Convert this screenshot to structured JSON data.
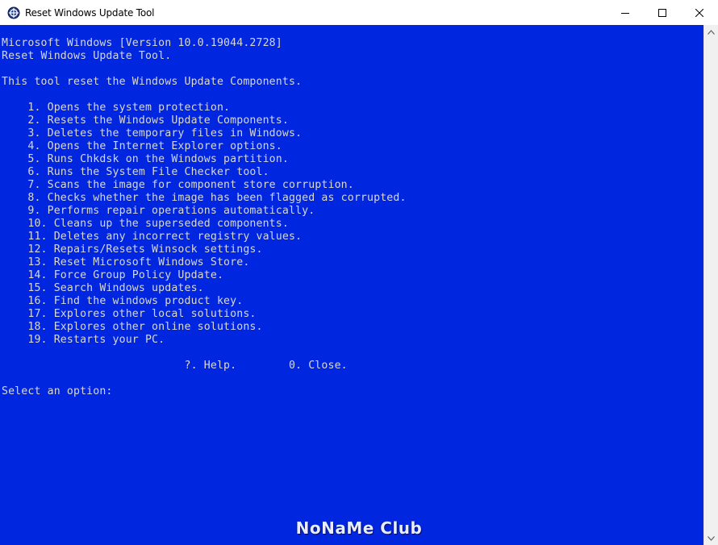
{
  "window": {
    "title": "Reset Windows Update Tool",
    "icon": "gear-app-icon",
    "controls": {
      "minimize_icon": "minimize-icon",
      "maximize_icon": "maximize-icon",
      "close_icon": "close-icon"
    }
  },
  "console": {
    "background": "#0026e0",
    "text_color": "#d8d8d8",
    "lines": [
      "Microsoft Windows [Version 10.0.19044.2728]",
      "Reset Windows Update Tool.",
      "",
      "This tool reset the Windows Update Components.",
      "",
      "    1. Opens the system protection.",
      "    2. Resets the Windows Update Components.",
      "    3. Deletes the temporary files in Windows.",
      "    4. Opens the Internet Explorer options.",
      "    5. Runs Chkdsk on the Windows partition.",
      "    6. Runs the System File Checker tool.",
      "    7. Scans the image for component store corruption.",
      "    8. Checks whether the image has been flagged as corrupted.",
      "    9. Performs repair operations automatically.",
      "    10. Cleans up the superseded components.",
      "    11. Deletes any incorrect registry values.",
      "    12. Repairs/Resets Winsock settings.",
      "    13. Reset Microsoft Windows Store.",
      "    14. Force Group Policy Update.",
      "    15. Search Windows updates.",
      "    16. Find the windows product key.",
      "    17. Explores other local solutions.",
      "    18. Explores other online solutions.",
      "    19. Restarts your PC.",
      "",
      "                            ?. Help.        0. Close.",
      "",
      "Select an option:"
    ]
  },
  "watermark": "NoNaMe Club"
}
